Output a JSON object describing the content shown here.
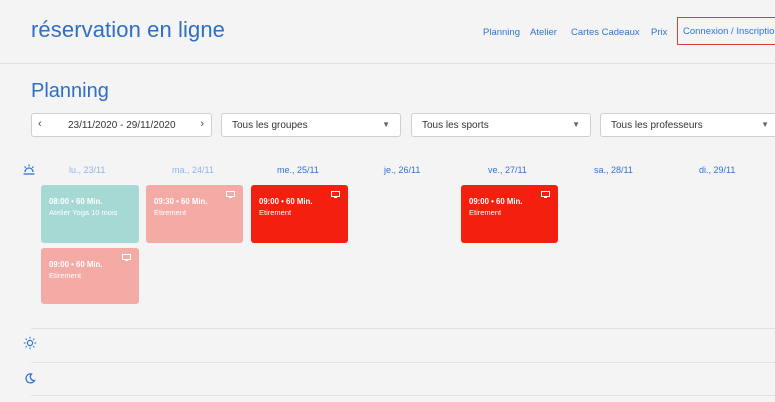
{
  "header": {
    "brand": "réservation en ligne",
    "nav": [
      {
        "label": "Planning"
      },
      {
        "label": "Atelier"
      },
      {
        "label": "Cartes Cadeaux"
      },
      {
        "label": "Prix"
      }
    ],
    "login_label": "Connexion / Inscription",
    "accent_color": "#2f74d0",
    "highlight_color": "#e23b3b"
  },
  "page_title": "Planning",
  "filters": {
    "date_range": "23/11/2020 - 29/11/2020",
    "groups": "Tous les groupes",
    "sports": "Tous les sports",
    "teachers": "Tous les professeurs"
  },
  "days": [
    {
      "label": "lu., 23/11",
      "state": "past"
    },
    {
      "label": "ma., 24/11",
      "state": "past"
    },
    {
      "label": "me., 25/11",
      "state": "future"
    },
    {
      "label": "je., 26/11",
      "state": "future"
    },
    {
      "label": "ve., 27/11",
      "state": "future"
    },
    {
      "label": "sa., 28/11",
      "state": "future"
    },
    {
      "label": "di., 29/11",
      "state": "future"
    }
  ],
  "sessions": [
    {
      "day": "lu., 23/11",
      "time": "08:00 • 60 Min.",
      "name": "Atelier Yoga 10 mois",
      "color": "#a6d9d4",
      "icon": "screen-icon-none"
    },
    {
      "day": "ma., 24/11",
      "time": "09:30 • 60 Min.",
      "name": "Etirement",
      "color": "#f4aba6",
      "icon": "screen-icon"
    },
    {
      "day": "me., 25/11",
      "time": "09:00 • 60 Min.",
      "name": "Etirement",
      "color": "#f31f0f",
      "icon": "screen-icon"
    },
    {
      "day": "ve., 27/11",
      "time": "09:00 • 60 Min.",
      "name": "Etirement",
      "color": "#f31f0f",
      "icon": "screen-icon"
    },
    {
      "day": "lu., 23/11",
      "time": "09:00 • 60 Min.",
      "name": "Etirement",
      "color": "#f4aba6",
      "icon": "screen-icon"
    }
  ],
  "periods": [
    {
      "icon": "sunrise-icon"
    },
    {
      "icon": "sun-icon"
    },
    {
      "icon": "moon-icon"
    }
  ]
}
